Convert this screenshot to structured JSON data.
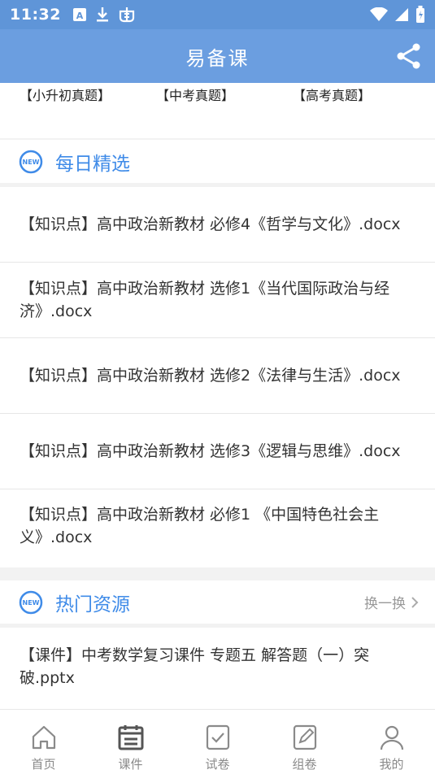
{
  "status": {
    "time": "11:32"
  },
  "header": {
    "title": "易备课"
  },
  "links": [
    "【小升初真题】",
    "【中考真题】",
    "【高考真题】"
  ],
  "daily": {
    "title": "每日精选",
    "items": [
      "【知识点】高中政治新教材 必修4《哲学与文化》.docx",
      "【知识点】高中政治新教材 选修1《当代国际政治与经济》.docx",
      "【知识点】高中政治新教材 选修2《法律与生活》.docx",
      "【知识点】高中政治新教材 选修3《逻辑与思维》.docx",
      "【知识点】高中政治新教材 必修1 《中国特色社会主义》.docx"
    ]
  },
  "hot": {
    "title": "热门资源",
    "more": "换一换",
    "items": [
      "【课件】中考数学复习课件 专题五   解答题（一）突破.pptx"
    ]
  },
  "tabs": [
    {
      "label": "首页",
      "icon": "home-icon"
    },
    {
      "label": "课件",
      "icon": "courseware-icon"
    },
    {
      "label": "试卷",
      "icon": "exam-icon"
    },
    {
      "label": "组卷",
      "icon": "compose-icon"
    },
    {
      "label": "我的",
      "icon": "profile-icon"
    }
  ],
  "colors": {
    "accent": "#3f8be8",
    "header": "#6b9ee0"
  }
}
